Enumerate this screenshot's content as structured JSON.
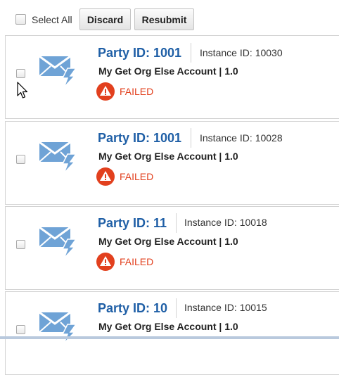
{
  "toolbar": {
    "select_all_label": "Select All",
    "discard_label": "Discard",
    "resubmit_label": "Resubmit"
  },
  "instances": [
    {
      "party_id": "Party ID: 1001",
      "instance_label": "Instance ID:",
      "instance_id": "10030",
      "name": "My Get Org Else Account | 1.0",
      "status": "FAILED"
    },
    {
      "party_id": "Party ID: 1001",
      "instance_label": "Instance ID:",
      "instance_id": "10028",
      "name": "My Get Org Else Account | 1.0",
      "status": "FAILED"
    },
    {
      "party_id": "Party ID: 11",
      "instance_label": "Instance ID:",
      "instance_id": "10018",
      "name": "My Get Org Else Account | 1.0",
      "status": "FAILED"
    },
    {
      "party_id": "Party ID: 10",
      "instance_label": "Instance ID:",
      "instance_id": "10015",
      "name": "My Get Org Else Account | 1.0",
      "status": ""
    }
  ],
  "icons": {
    "message": "envelope-lightning-icon",
    "status": "warning-icon",
    "pointer": "mouse-cursor-icon"
  },
  "colors": {
    "link": "#1f5fa6",
    "failed": "#e2401e",
    "icon": "#6fa3d6"
  }
}
